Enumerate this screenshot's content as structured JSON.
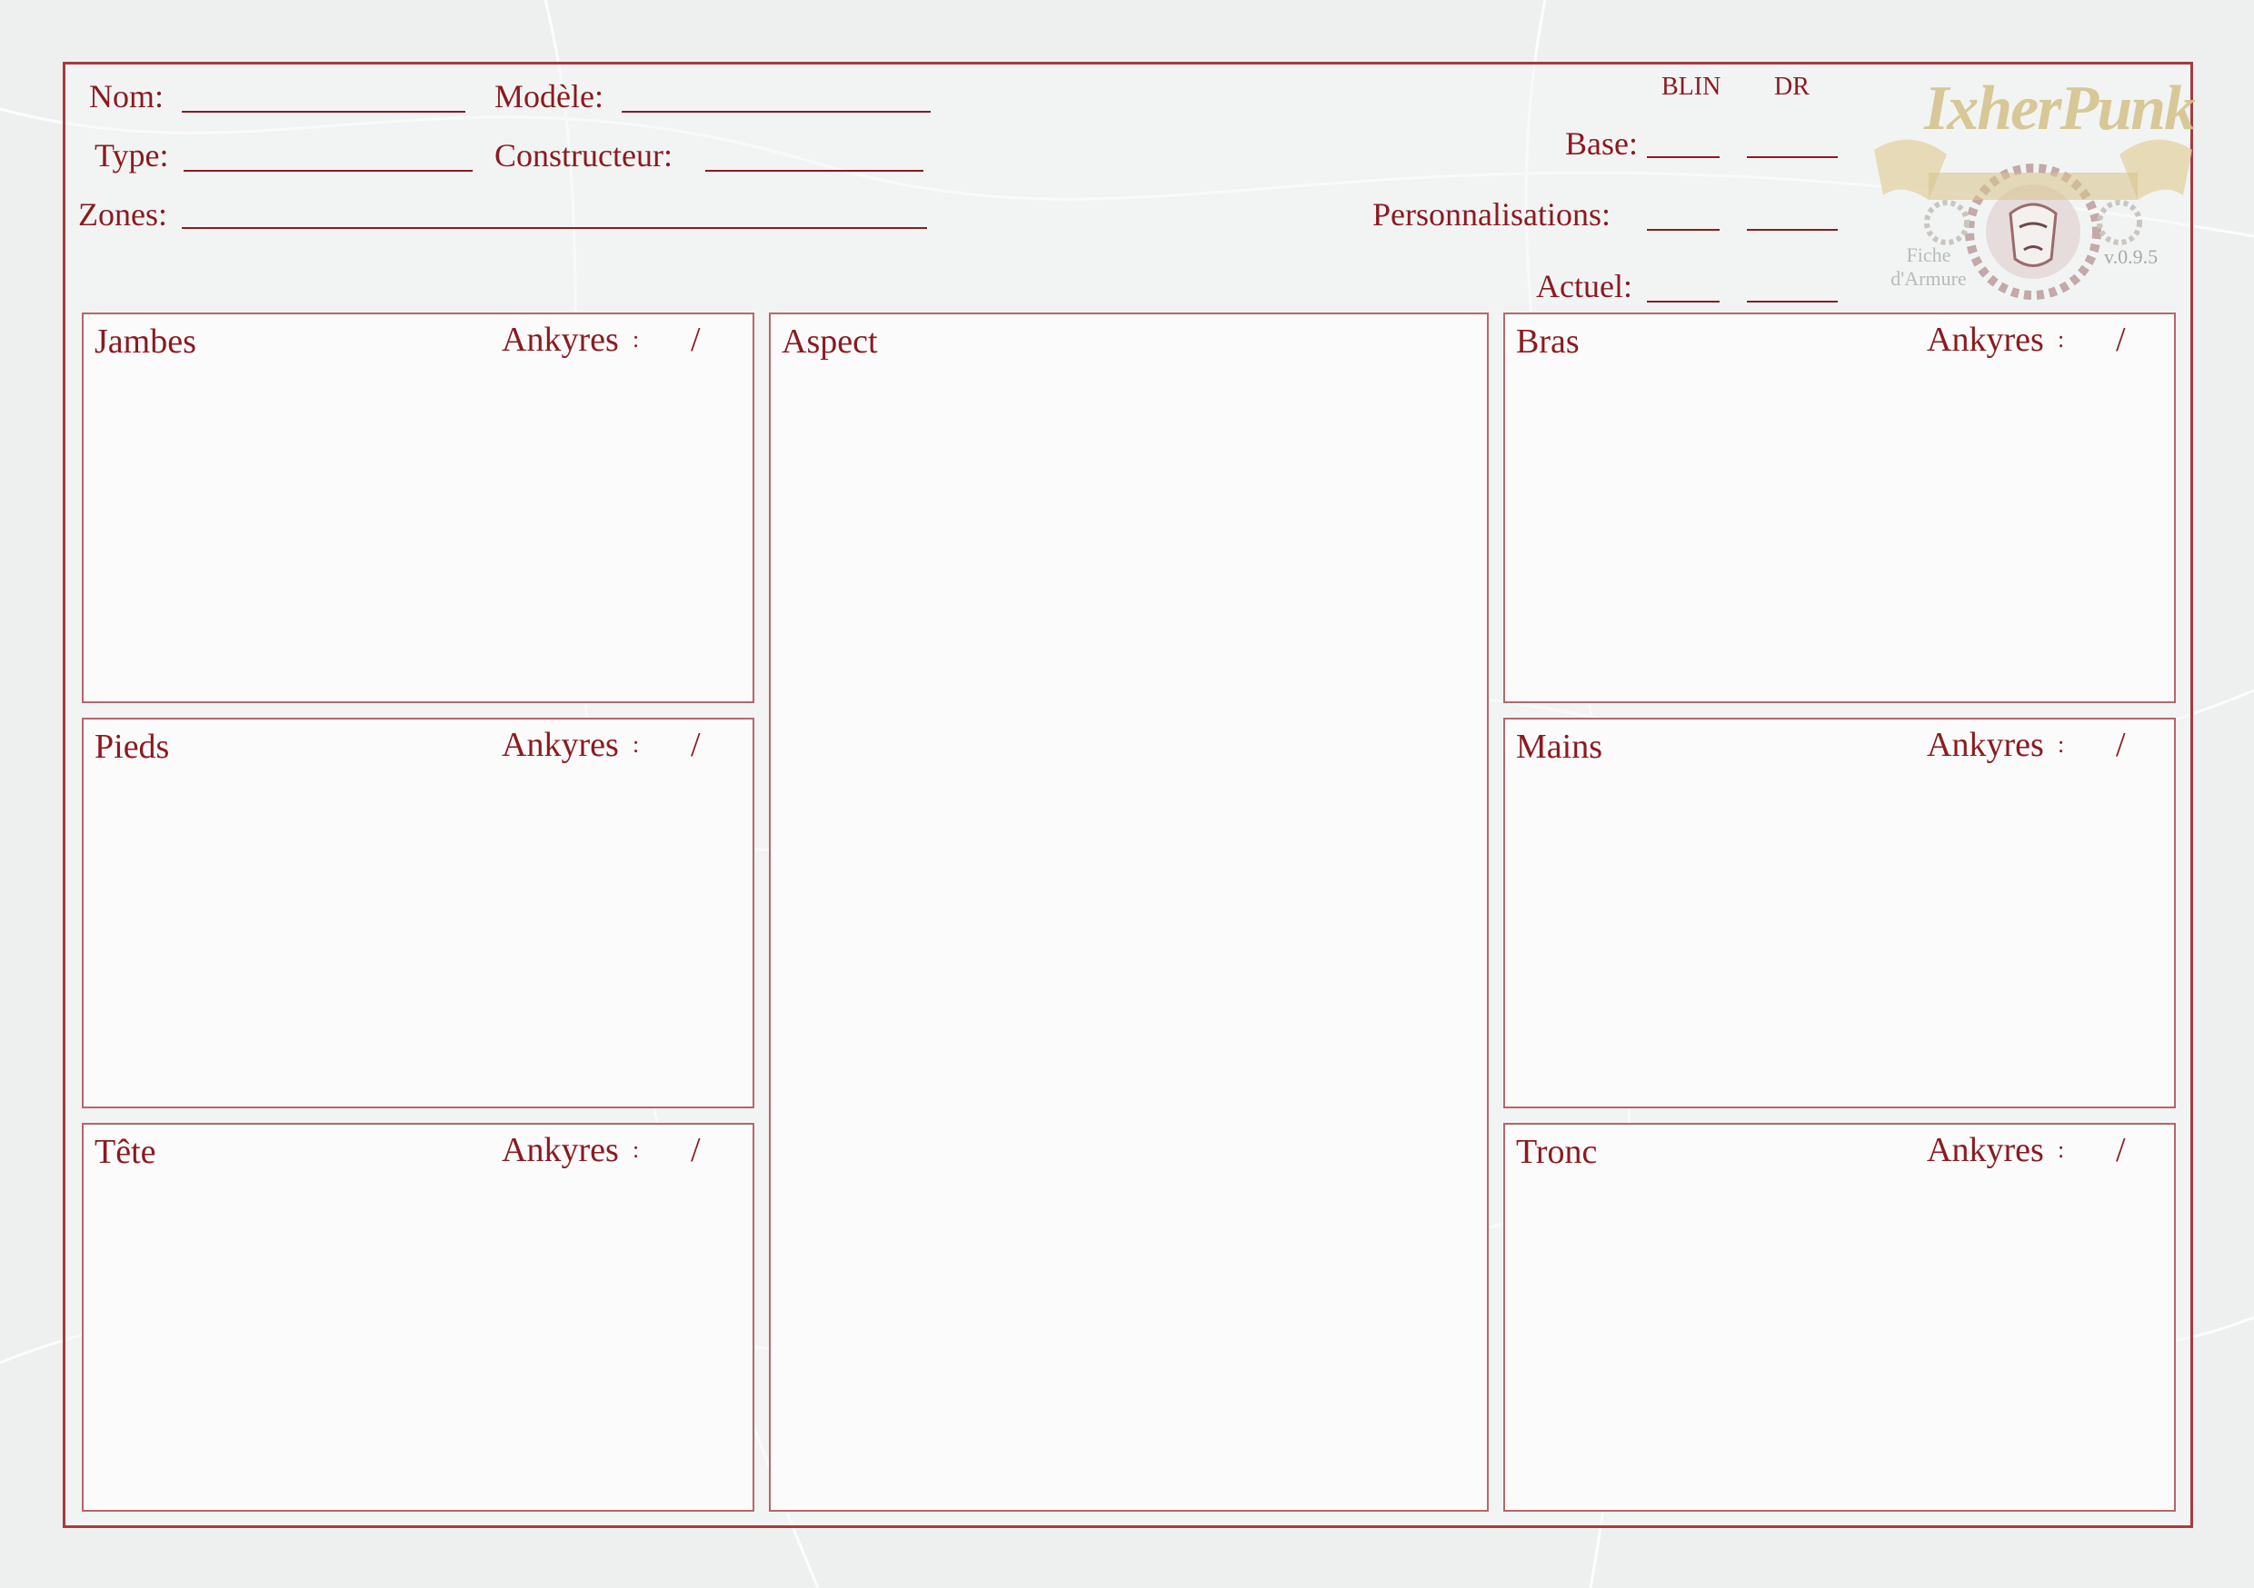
{
  "header": {
    "nom_label": "Nom:",
    "modele_label": "Modèle:",
    "type_label": "Type:",
    "constructeur_label": "Constructeur:",
    "zones_label": "Zones:"
  },
  "stats": {
    "blin_label": "BLIN",
    "dr_label": "DR",
    "base_label": "Base:",
    "perso_label": "Personnalisations:",
    "actuel_label": "Actuel:"
  },
  "logo": {
    "brand": "IxherPunk",
    "subtitle_line1": "Fiche",
    "subtitle_line2": "d'Armure",
    "version": "v.0.9.5",
    "colors": {
      "gold": "#d9c48a",
      "grey": "#b5b2ab",
      "red": "#a0505a"
    }
  },
  "panels": {
    "ankyres_label": "Ankyres",
    "colon": ":",
    "slash": "/",
    "jambes": "Jambes",
    "pieds": "Pieds",
    "tete": "Tête",
    "aspect": "Aspect",
    "bras": "Bras",
    "mains": "Mains",
    "tronc": "Tronc"
  },
  "colors": {
    "accent": "#8b1a1f",
    "panel_border": "#b8656a",
    "background": "#eef0f0"
  }
}
